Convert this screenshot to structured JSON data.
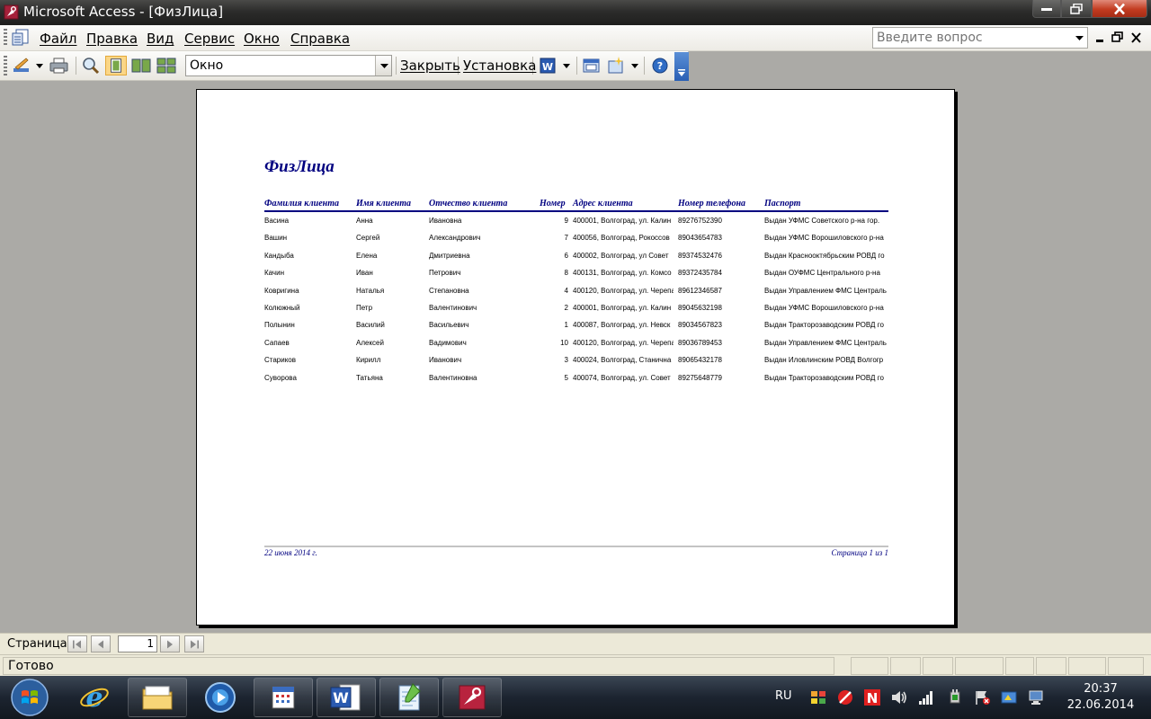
{
  "window": {
    "title": "Microsoft Access - [ФизЛица]"
  },
  "menu": {
    "items": [
      "Файл",
      "Правка",
      "Вид",
      "Сервис",
      "Окно",
      "Справка"
    ],
    "ask_placeholder": "Введите вопрос"
  },
  "toolbar": {
    "zoom_value": "Окно",
    "close_label": "Закрыть",
    "setup_label": "Установка"
  },
  "report": {
    "title": "ФизЛица",
    "columns": [
      "Фамилия клиента",
      "Имя клиента",
      "Отчество клиента",
      "Номер",
      "Адрес клиента",
      "Номер телефона",
      "Паспорт"
    ],
    "rows": [
      [
        "Васина",
        "Анна",
        "Ивановна",
        "9",
        "400001, Волгоград, ул. Калин",
        "89276752390",
        "Выдан УФМС Советского р-на  гор."
      ],
      [
        "Вашин",
        "Сергей",
        "Александрович",
        "7",
        "400056, Волгоград, Рокоссов",
        "89043654783",
        "Выдан УФМС Ворошиловского р-на"
      ],
      [
        "Кандыба",
        "Елена",
        "Дмитриевна",
        "6",
        "400002, Волгоград, ул Совет",
        "89374532476",
        "Выдан Краснооктябрьским РОВД го"
      ],
      [
        "Качин",
        "Иван",
        "Петрович",
        "8",
        "400131, Волгоград, ул. Комсо",
        "89372435784",
        "Выдан ОУФМС Центрального р-на"
      ],
      [
        "Ковригина",
        "Наталья",
        "Степановна",
        "4",
        "400120, Волгоград, ул. Черепа",
        "89612346587",
        "Выдан Управлением ФМС Централь"
      ],
      [
        "Колюжный",
        "Петр",
        "Валентинович",
        "2",
        "400001, Волгоград, ул. Калин",
        "89045632198",
        "Выдан УФМС Ворошиловского р-на"
      ],
      [
        "Полынин",
        "Василий",
        "Васильевич",
        "1",
        "400087, Волгоград, ул. Невск",
        "89034567823",
        "Выдан Тракторозаводским РОВД го"
      ],
      [
        "Сапаев",
        "Алексей",
        "Вадимович",
        "10",
        "400120, Волгоград, ул. Черепа",
        "89036789453",
        "Выдан Управлением ФМС Централь"
      ],
      [
        "Стариков",
        "Кирилл",
        "Иванович",
        "3",
        "400024, Волгоград, Станична",
        "89065432178",
        "Выдан Иловлинским РОВД Волгогр"
      ],
      [
        "Суворова",
        "Татьяна",
        "Валентиновна",
        "5",
        "400074, Волгоград, ул. Совет",
        "89275648779",
        "Выдан Тракторозаводским РОВД го"
      ]
    ],
    "footer_date": "22 июня 2014 г.",
    "footer_page": "Страница 1 из 1"
  },
  "navigator": {
    "label": "Страница:",
    "current_page": "1"
  },
  "status": {
    "text": "Готово"
  },
  "taskbar": {
    "language": "RU",
    "time": "20:37",
    "date": "22.06.2014"
  },
  "colors": {
    "report_accent": "#000080",
    "titlebar": "#2c2c2b",
    "workspace": "#abaaa6",
    "close_button": "#c23b20"
  },
  "icons": [
    "access-key-icon",
    "report-doc-icon",
    "design-view-icon",
    "print-icon",
    "zoom-icon",
    "one-page-icon",
    "two-pages-icon",
    "multiple-pages-icon",
    "word-export-icon",
    "database-window-icon",
    "new-object-icon",
    "help-icon",
    "first-page-icon",
    "prev-page-icon",
    "next-page-icon",
    "last-page-icon",
    "windows-start-icon",
    "internet-explorer-icon",
    "folder-icon",
    "media-player-icon",
    "calendar-app-icon",
    "word-icon",
    "notepad-icon",
    "access-icon"
  ]
}
